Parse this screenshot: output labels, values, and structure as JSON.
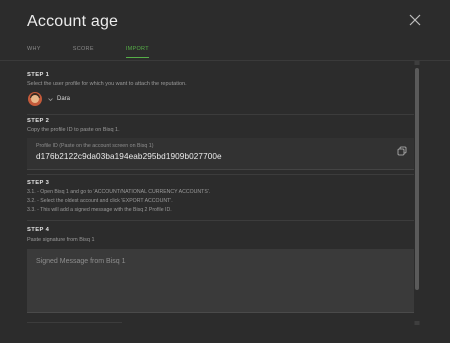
{
  "dialog": {
    "title": "Account age"
  },
  "tabs": [
    {
      "label": "WHY",
      "active": false
    },
    {
      "label": "SCORE",
      "active": false
    },
    {
      "label": "IMPORT",
      "active": true
    }
  ],
  "step1": {
    "label": "STEP 1",
    "description": "Select the user profile for which you want to attach the reputation.",
    "profile_name": "Dara"
  },
  "step2": {
    "label": "STEP 2",
    "description": "Copy the profile ID to paste on Bisq 1.",
    "field_label": "Profile ID (Paste on the account screen on Bisq 1)",
    "field_value": "d176b2122c9da03ba194eab295bd1909b027700e"
  },
  "step3": {
    "label": "STEP 3",
    "lines": [
      "3.1. - Open Bisq 1 and go to 'ACCOUNT/NATIONAL CURRENCY ACCOUNTS'.",
      "3.2. - Select the oldest account and click 'EXPORT ACCOUNT'.",
      "3.3. - This will add a signed message with the Bisq 2 Profile ID."
    ]
  },
  "step4": {
    "label": "STEP 4",
    "description": "Paste signature from Bisq 1",
    "input_placeholder": "Signed Message from Bisq 1"
  },
  "colors": {
    "accent": "#56ae48",
    "background": "#2c2c2c"
  },
  "icons": {
    "close": "close-icon",
    "copy": "copy-icon",
    "dropdown": "chevron-down-icon"
  }
}
